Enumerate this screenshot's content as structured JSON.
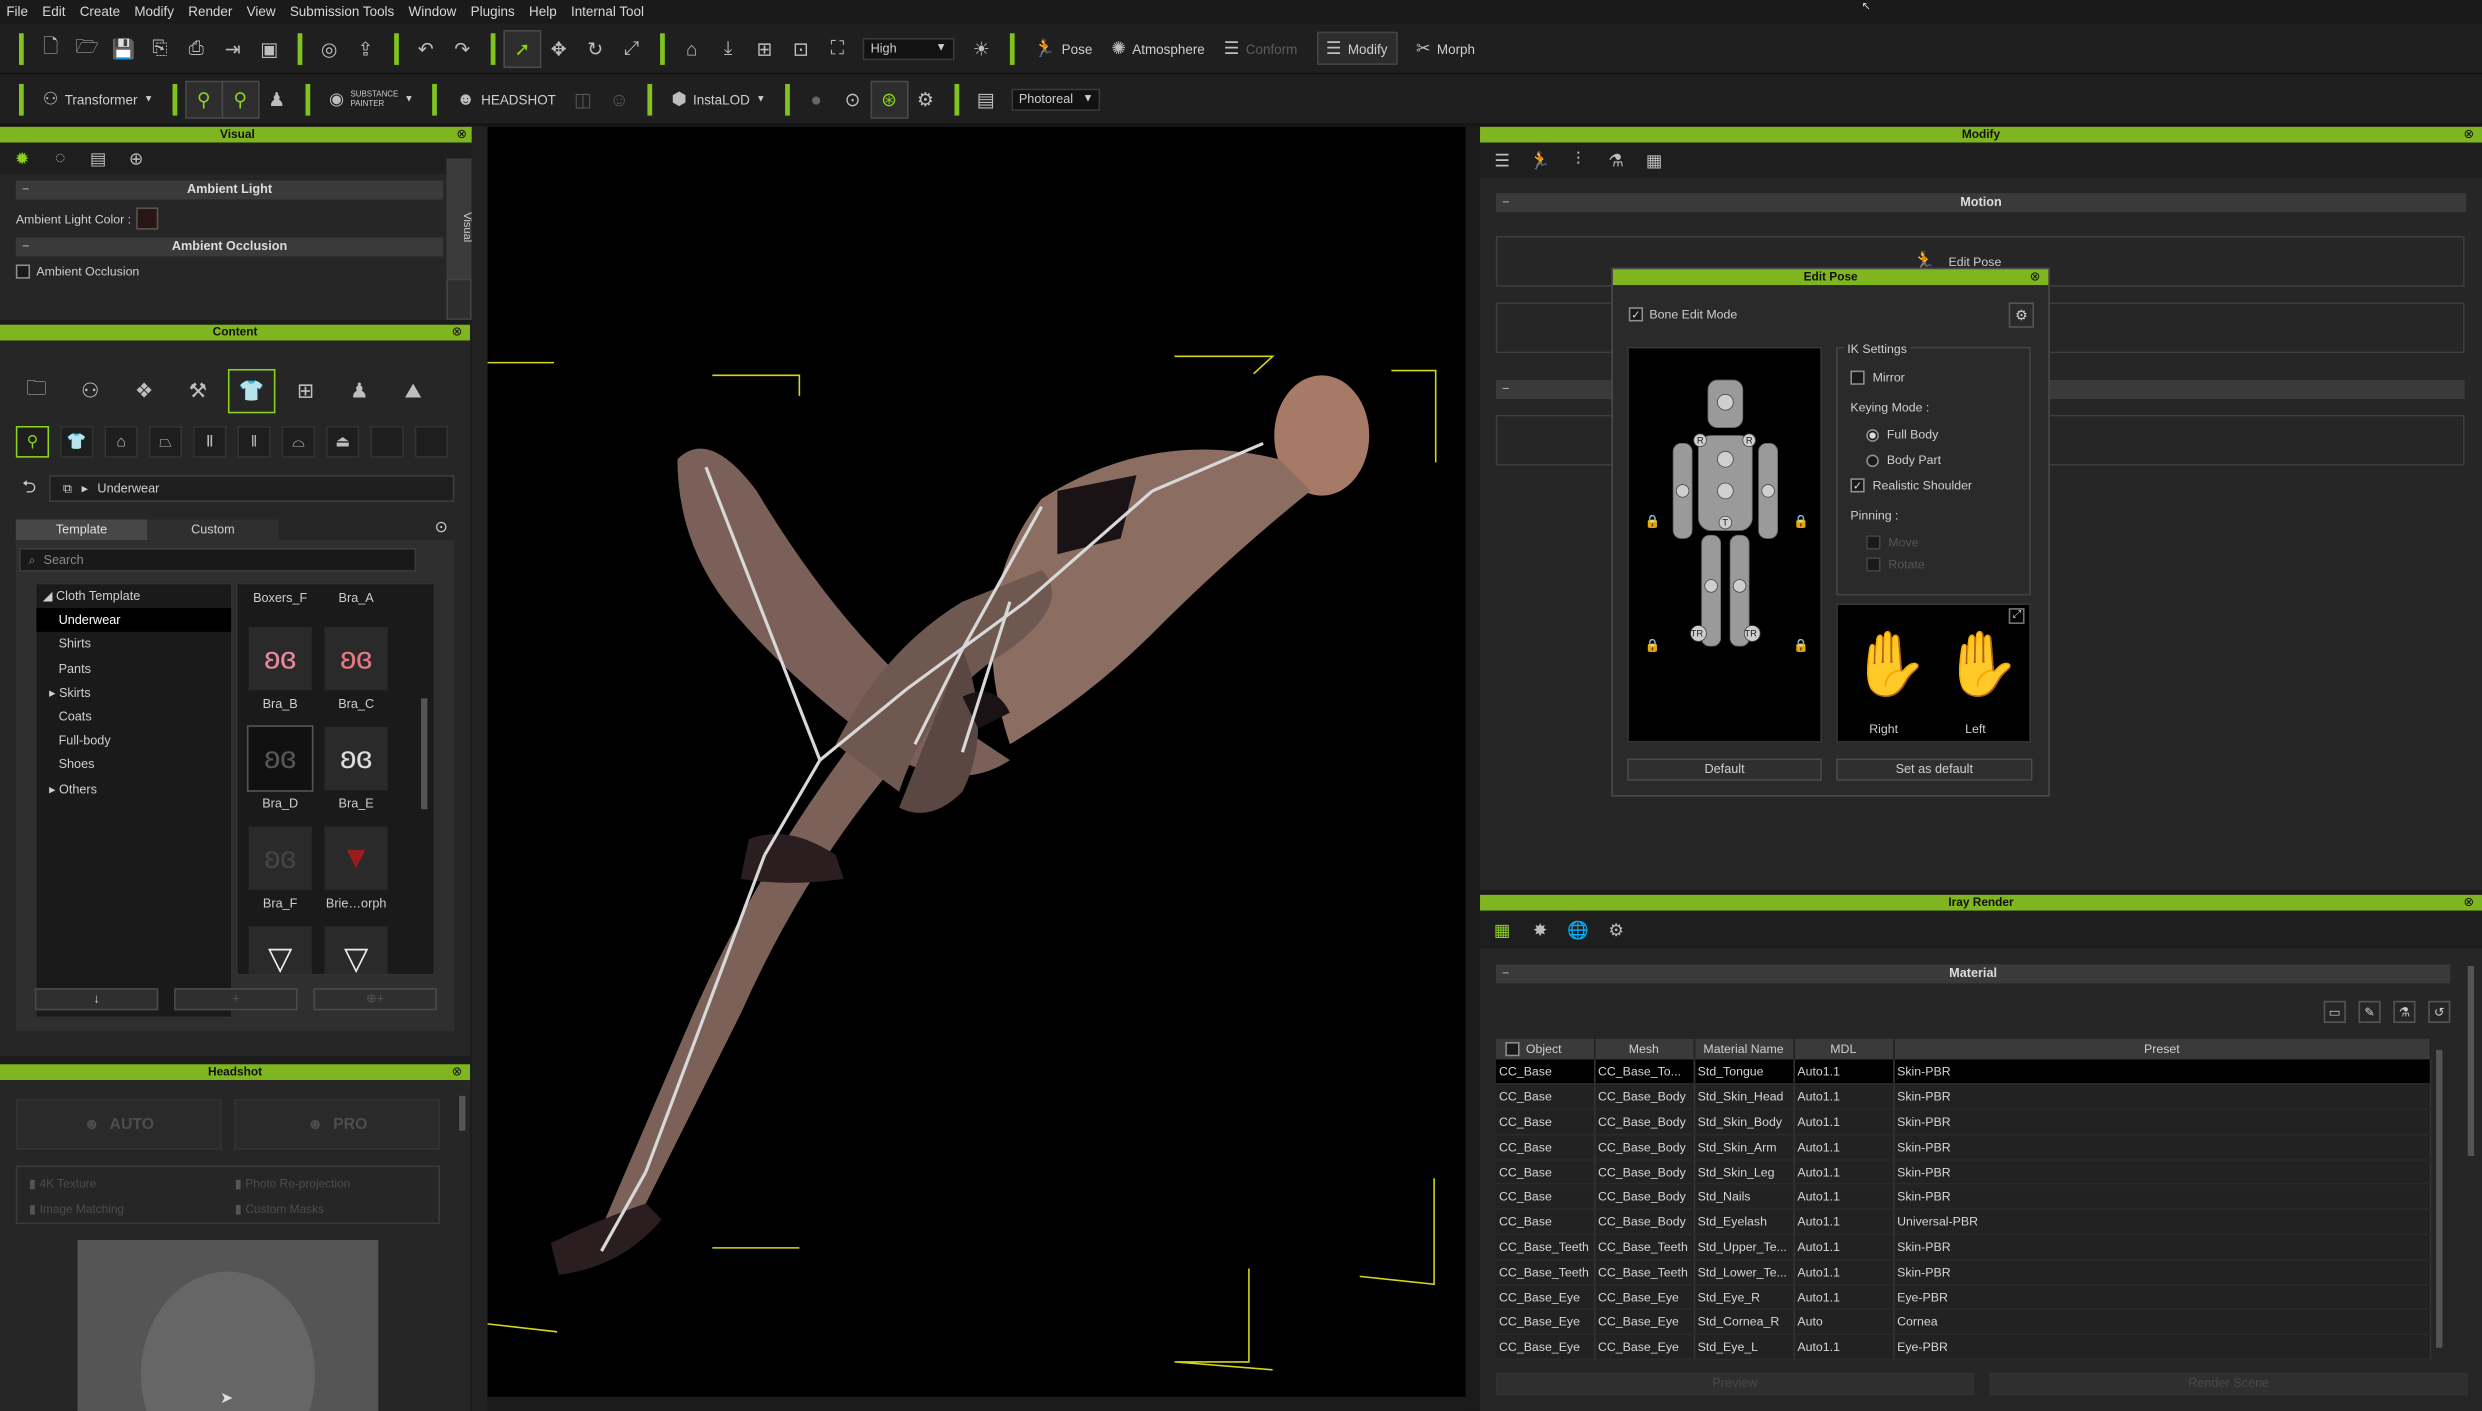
{
  "menu": [
    "File",
    "Edit",
    "Create",
    "Modify",
    "Render",
    "View",
    "Submission Tools",
    "Window",
    "Plugins",
    "Help",
    "Internal Tool"
  ],
  "toolbar1": {
    "quality": "High",
    "pose_label": "Pose",
    "atmosphere_label": "Atmosphere",
    "conform_label": "Conform",
    "modify_label": "Modify",
    "morph_label": "Morph"
  },
  "toolbar2": {
    "transformer_label": "Transformer",
    "substance_label": "SUBSTANCE PAINTER",
    "headshot_label": "HEADSHOT",
    "instalod_label": "InstaLOD",
    "render_mode": "Photoreal"
  },
  "visual": {
    "title": "Visual",
    "side_tab": "Visual",
    "ambient_light_header": "Ambient Light",
    "ambient_light_color_label": "Ambient Light Color :",
    "ambient_light_color": "#2a1414",
    "ambient_occlusion_header": "Ambient Occlusion",
    "ambient_occlusion_label": "Ambient Occlusion"
  },
  "content": {
    "title": "Content",
    "breadcrumb": "Underwear",
    "tabs": [
      "Template",
      "Custom"
    ],
    "search_placeholder": "Search",
    "tree": {
      "root": "Cloth Template",
      "items": [
        "Underwear",
        "Shirts",
        "Pants",
        "Skirts",
        "Coats",
        "Full-body",
        "Shoes",
        "Others"
      ]
    },
    "thumbs": [
      "Boxers_F",
      "Bra_A",
      "Bra_B",
      "Bra_C",
      "Bra_D",
      "Bra_E",
      "Bra_F",
      "Brie…orph",
      "",
      ""
    ]
  },
  "headshot": {
    "title": "Headshot",
    "auto_label": "AUTO",
    "pro_label": "PRO",
    "options": [
      "4K Texture",
      "Photo Re-projection",
      "Image Matching",
      "Custom Masks"
    ]
  },
  "modify": {
    "title": "Modify",
    "motion_header": "Motion",
    "edit_pose_button": "Edit Pose"
  },
  "edit_pose": {
    "title": "Edit Pose",
    "bone_edit_mode": "Bone Edit Mode",
    "ik_settings": "IK Settings",
    "mirror": "Mirror",
    "keying_mode": "Keying Mode :",
    "full_body": "Full Body",
    "body_part": "Body Part",
    "realistic_shoulder": "Realistic Shoulder",
    "pinning": "Pinning :",
    "move": "Move",
    "rotate": "Rotate",
    "right": "Right",
    "left": "Left",
    "default_btn": "Default",
    "set_default_btn": "Set as default"
  },
  "iray": {
    "title": "Iray Render",
    "material_header": "Material",
    "columns": [
      "Object",
      "Mesh",
      "Material Name",
      "MDL",
      "Preset"
    ],
    "rows": [
      [
        "CC_Base",
        "CC_Base_To...",
        "Std_Tongue",
        "Auto1.1",
        "Skin-PBR"
      ],
      [
        "CC_Base",
        "CC_Base_Body",
        "Std_Skin_Head",
        "Auto1.1",
        "Skin-PBR"
      ],
      [
        "CC_Base",
        "CC_Base_Body",
        "Std_Skin_Body",
        "Auto1.1",
        "Skin-PBR"
      ],
      [
        "CC_Base",
        "CC_Base_Body",
        "Std_Skin_Arm",
        "Auto1.1",
        "Skin-PBR"
      ],
      [
        "CC_Base",
        "CC_Base_Body",
        "Std_Skin_Leg",
        "Auto1.1",
        "Skin-PBR"
      ],
      [
        "CC_Base",
        "CC_Base_Body",
        "Std_Nails",
        "Auto1.1",
        "Skin-PBR"
      ],
      [
        "CC_Base",
        "CC_Base_Body",
        "Std_Eyelash",
        "Auto1.1",
        "Universal-PBR"
      ],
      [
        "CC_Base_Teeth",
        "CC_Base_Teeth",
        "Std_Upper_Te...",
        "Auto1.1",
        "Skin-PBR"
      ],
      [
        "CC_Base_Teeth",
        "CC_Base_Teeth",
        "Std_Lower_Te...",
        "Auto1.1",
        "Skin-PBR"
      ],
      [
        "CC_Base_Eye",
        "CC_Base_Eye",
        "Std_Eye_R",
        "Auto1.1",
        "Eye-PBR"
      ],
      [
        "CC_Base_Eye",
        "CC_Base_Eye",
        "Std_Cornea_R",
        "Auto",
        "Cornea"
      ],
      [
        "CC_Base_Eye",
        "CC_Base_Eye",
        "Std_Eye_L",
        "Auto1.1",
        "Eye-PBR"
      ]
    ],
    "preview_btn": "Preview",
    "render_btn": "Render Scene"
  },
  "colors": {
    "accent": "#7fb51e",
    "panel_bg": "#262626",
    "viewport_bg": "#000000"
  }
}
